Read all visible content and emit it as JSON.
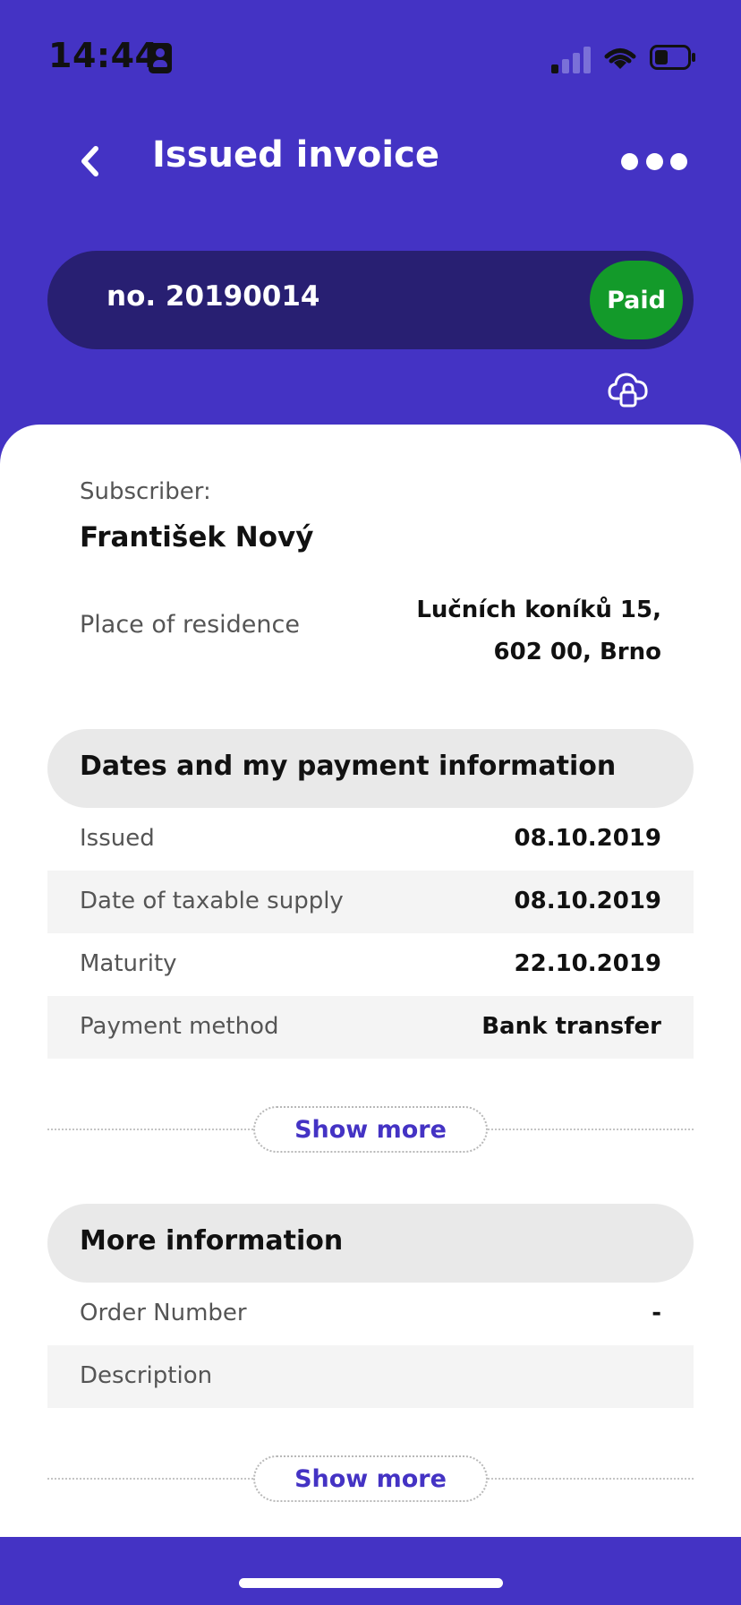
{
  "status_bar": {
    "time": "14:44",
    "colors": {
      "signal_active": "#111111",
      "signal_inactive": "#7a70d8"
    }
  },
  "header": {
    "title": "Issued invoice",
    "back_icon": "chevron-left-icon",
    "more_icon": "more-horizontal-icon"
  },
  "invoice": {
    "number": "no. 20190014",
    "status": "Paid",
    "lock_icon": "cloud-lock-icon"
  },
  "subscriber": {
    "label": "Subscriber:",
    "name": "František Nový",
    "residence_label": "Place of residence",
    "residence_value": "Lučních koníků 15, 602 00, Brno"
  },
  "dates_section": {
    "title": "Dates and my payment information",
    "rows": [
      {
        "label": "Issued",
        "value": "08.10.2019"
      },
      {
        "label": "Date of taxable supply",
        "value": "08.10.2019"
      },
      {
        "label": "Maturity",
        "value": "22.10.2019"
      },
      {
        "label": "Payment method",
        "value": "Bank transfer"
      }
    ],
    "show_more": "Show more"
  },
  "more_section": {
    "title": "More information",
    "rows": [
      {
        "label": "Order Number",
        "value": "-"
      },
      {
        "label": "Description",
        "value": ""
      }
    ],
    "show_more": "Show more"
  },
  "colors": {
    "brand_primary": "#4433c4",
    "pill_dark": "#281f72",
    "paid_green": "#139a2a",
    "section_header_bg": "#e9e9e9",
    "row_shaded_bg": "#f4f4f4"
  }
}
